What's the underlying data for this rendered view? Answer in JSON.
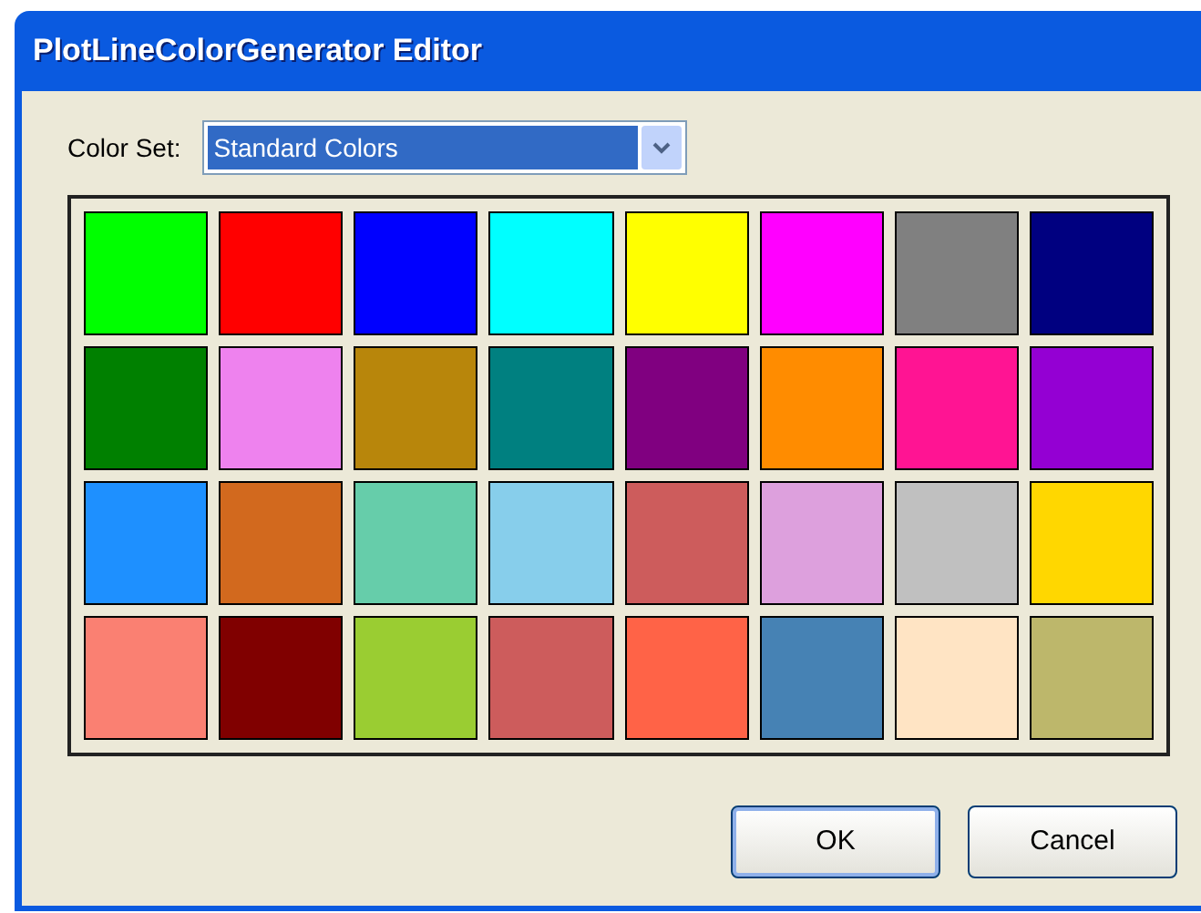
{
  "window": {
    "title": "PlotLineColorGenerator Editor"
  },
  "color_set": {
    "label": "Color Set:",
    "value": "Standard Colors"
  },
  "swatches": [
    {
      "color": "#00ff00"
    },
    {
      "color": "#ff0000"
    },
    {
      "color": "#0000ff"
    },
    {
      "color": "#00ffff"
    },
    {
      "color": "#ffff00"
    },
    {
      "color": "#ff00ff"
    },
    {
      "color": "#808080"
    },
    {
      "color": "#000080"
    },
    {
      "color": "#008000"
    },
    {
      "color": "#ee82ee"
    },
    {
      "color": "#b8860b"
    },
    {
      "color": "#008080"
    },
    {
      "color": "#800080"
    },
    {
      "color": "#ff8c00"
    },
    {
      "color": "#ff1493"
    },
    {
      "color": "#9400d3"
    },
    {
      "color": "#1e90ff"
    },
    {
      "color": "#d2691e"
    },
    {
      "color": "#66cdaa"
    },
    {
      "color": "#87ceeb"
    },
    {
      "color": "#cd5c5c"
    },
    {
      "color": "#dda0dd"
    },
    {
      "color": "#c0c0c0"
    },
    {
      "color": "#ffd700"
    },
    {
      "color": "#fa8072"
    },
    {
      "color": "#800000"
    },
    {
      "color": "#9acd32"
    },
    {
      "color": "#cd5c5c"
    },
    {
      "color": "#ff6347"
    },
    {
      "color": "#4682b4"
    },
    {
      "color": "#ffe4c4"
    },
    {
      "color": "#bdb76b"
    }
  ],
  "buttons": [
    "OK",
    "Cancel"
  ]
}
